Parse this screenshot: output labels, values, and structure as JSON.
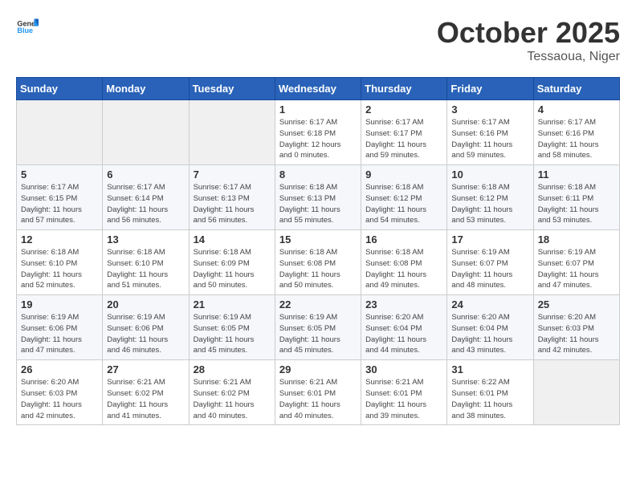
{
  "logo": {
    "text_general": "General",
    "text_blue": "Blue"
  },
  "title": "October 2025",
  "location": "Tessaoua, Niger",
  "days_header": [
    "Sunday",
    "Monday",
    "Tuesday",
    "Wednesday",
    "Thursday",
    "Friday",
    "Saturday"
  ],
  "weeks": [
    [
      {
        "day": "",
        "info": ""
      },
      {
        "day": "",
        "info": ""
      },
      {
        "day": "",
        "info": ""
      },
      {
        "day": "1",
        "info": "Sunrise: 6:17 AM\nSunset: 6:18 PM\nDaylight: 12 hours\nand 0 minutes."
      },
      {
        "day": "2",
        "info": "Sunrise: 6:17 AM\nSunset: 6:17 PM\nDaylight: 11 hours\nand 59 minutes."
      },
      {
        "day": "3",
        "info": "Sunrise: 6:17 AM\nSunset: 6:16 PM\nDaylight: 11 hours\nand 59 minutes."
      },
      {
        "day": "4",
        "info": "Sunrise: 6:17 AM\nSunset: 6:16 PM\nDaylight: 11 hours\nand 58 minutes."
      }
    ],
    [
      {
        "day": "5",
        "info": "Sunrise: 6:17 AM\nSunset: 6:15 PM\nDaylight: 11 hours\nand 57 minutes."
      },
      {
        "day": "6",
        "info": "Sunrise: 6:17 AM\nSunset: 6:14 PM\nDaylight: 11 hours\nand 56 minutes."
      },
      {
        "day": "7",
        "info": "Sunrise: 6:17 AM\nSunset: 6:13 PM\nDaylight: 11 hours\nand 56 minutes."
      },
      {
        "day": "8",
        "info": "Sunrise: 6:18 AM\nSunset: 6:13 PM\nDaylight: 11 hours\nand 55 minutes."
      },
      {
        "day": "9",
        "info": "Sunrise: 6:18 AM\nSunset: 6:12 PM\nDaylight: 11 hours\nand 54 minutes."
      },
      {
        "day": "10",
        "info": "Sunrise: 6:18 AM\nSunset: 6:12 PM\nDaylight: 11 hours\nand 53 minutes."
      },
      {
        "day": "11",
        "info": "Sunrise: 6:18 AM\nSunset: 6:11 PM\nDaylight: 11 hours\nand 53 minutes."
      }
    ],
    [
      {
        "day": "12",
        "info": "Sunrise: 6:18 AM\nSunset: 6:10 PM\nDaylight: 11 hours\nand 52 minutes."
      },
      {
        "day": "13",
        "info": "Sunrise: 6:18 AM\nSunset: 6:10 PM\nDaylight: 11 hours\nand 51 minutes."
      },
      {
        "day": "14",
        "info": "Sunrise: 6:18 AM\nSunset: 6:09 PM\nDaylight: 11 hours\nand 50 minutes."
      },
      {
        "day": "15",
        "info": "Sunrise: 6:18 AM\nSunset: 6:08 PM\nDaylight: 11 hours\nand 50 minutes."
      },
      {
        "day": "16",
        "info": "Sunrise: 6:18 AM\nSunset: 6:08 PM\nDaylight: 11 hours\nand 49 minutes."
      },
      {
        "day": "17",
        "info": "Sunrise: 6:19 AM\nSunset: 6:07 PM\nDaylight: 11 hours\nand 48 minutes."
      },
      {
        "day": "18",
        "info": "Sunrise: 6:19 AM\nSunset: 6:07 PM\nDaylight: 11 hours\nand 47 minutes."
      }
    ],
    [
      {
        "day": "19",
        "info": "Sunrise: 6:19 AM\nSunset: 6:06 PM\nDaylight: 11 hours\nand 47 minutes."
      },
      {
        "day": "20",
        "info": "Sunrise: 6:19 AM\nSunset: 6:06 PM\nDaylight: 11 hours\nand 46 minutes."
      },
      {
        "day": "21",
        "info": "Sunrise: 6:19 AM\nSunset: 6:05 PM\nDaylight: 11 hours\nand 45 minutes."
      },
      {
        "day": "22",
        "info": "Sunrise: 6:19 AM\nSunset: 6:05 PM\nDaylight: 11 hours\nand 45 minutes."
      },
      {
        "day": "23",
        "info": "Sunrise: 6:20 AM\nSunset: 6:04 PM\nDaylight: 11 hours\nand 44 minutes."
      },
      {
        "day": "24",
        "info": "Sunrise: 6:20 AM\nSunset: 6:04 PM\nDaylight: 11 hours\nand 43 minutes."
      },
      {
        "day": "25",
        "info": "Sunrise: 6:20 AM\nSunset: 6:03 PM\nDaylight: 11 hours\nand 42 minutes."
      }
    ],
    [
      {
        "day": "26",
        "info": "Sunrise: 6:20 AM\nSunset: 6:03 PM\nDaylight: 11 hours\nand 42 minutes."
      },
      {
        "day": "27",
        "info": "Sunrise: 6:21 AM\nSunset: 6:02 PM\nDaylight: 11 hours\nand 41 minutes."
      },
      {
        "day": "28",
        "info": "Sunrise: 6:21 AM\nSunset: 6:02 PM\nDaylight: 11 hours\nand 40 minutes."
      },
      {
        "day": "29",
        "info": "Sunrise: 6:21 AM\nSunset: 6:01 PM\nDaylight: 11 hours\nand 40 minutes."
      },
      {
        "day": "30",
        "info": "Sunrise: 6:21 AM\nSunset: 6:01 PM\nDaylight: 11 hours\nand 39 minutes."
      },
      {
        "day": "31",
        "info": "Sunrise: 6:22 AM\nSunset: 6:01 PM\nDaylight: 11 hours\nand 38 minutes."
      },
      {
        "day": "",
        "info": ""
      }
    ]
  ]
}
